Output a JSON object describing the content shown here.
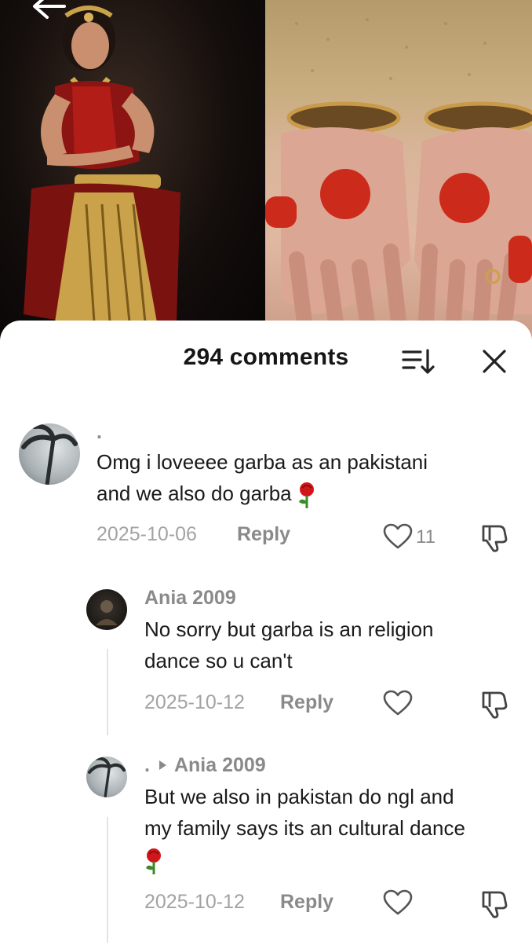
{
  "sheet": {
    "title": "294 comments"
  },
  "comments": [
    {
      "username": ".",
      "text_line1": "Omg i loveeee garba as an pakistani",
      "text_line2": "and we also do garba",
      "date": "2025-10-06",
      "reply_label": "Reply",
      "likes": "11"
    },
    {
      "username": "Ania 2009",
      "text_line1": "No sorry but garba is an religion",
      "text_line2": "dance so u can't",
      "date": "2025-10-12",
      "reply_label": "Reply"
    },
    {
      "username": ".",
      "reply_to": "Ania 2009",
      "text_line1": "But we also in pakistan do ngl and",
      "text_line2": "my family says its an cultural dance",
      "date": "2025-10-12",
      "reply_label": "Reply"
    }
  ],
  "icons": {
    "back": "back-arrow-icon",
    "search": "search-icon",
    "sort": "sort-icon",
    "close": "close-icon",
    "like": "heart-icon",
    "dislike": "dislike-icon",
    "emoji": "rose-emoji"
  }
}
